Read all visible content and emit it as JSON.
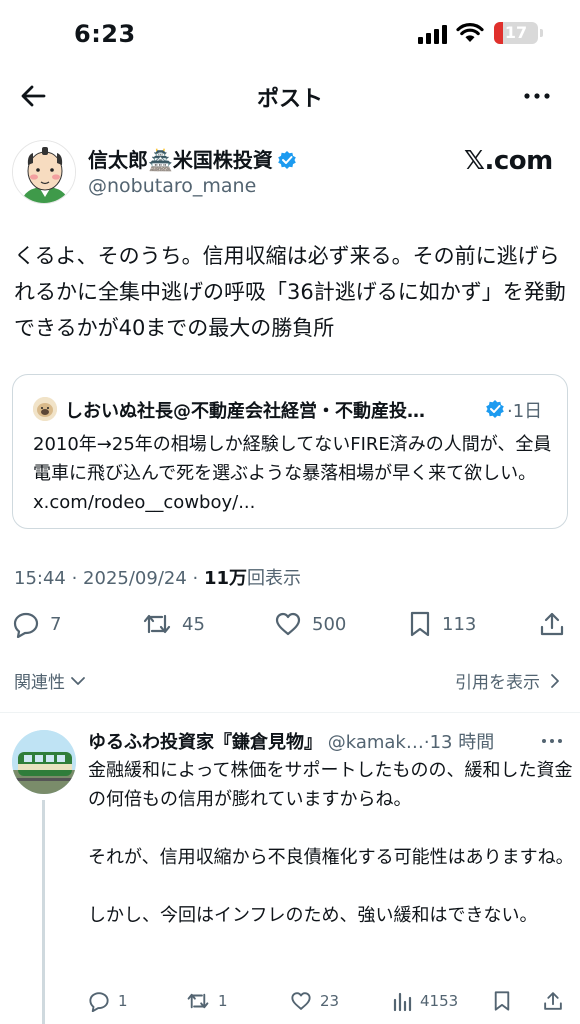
{
  "status": {
    "time": "6:23",
    "battery": "17"
  },
  "nav": {
    "title": "ポスト"
  },
  "author": {
    "name": "信太郎🏯米国株投資",
    "handle": "@nobutaro_mane",
    "source": "𝕏.com"
  },
  "tweet": {
    "text": "くるよ、そのうち。信用収縮は必ず来る。その前に逃げられるかに全集中逃げの呼吸「36計逃げるに如かず」を発動できるかが40までの最大の勝負所",
    "timestamp": "15:44 · 2025/09/24 · ",
    "views": "11万",
    "views_suffix": "回表示"
  },
  "quote": {
    "name": "しおいぬ社長@不動産会社経営・不動産投…",
    "time": "·1日",
    "text": "2010年→25年の相場しか経験してないFIRE済みの人間が、全員電車に飛び込んで死を選ぶような暴落相場が早く来て欲しい。 x.com/rodeo__cowboy/..."
  },
  "actions": {
    "replies": "7",
    "reposts": "45",
    "likes": "500",
    "bookmarks": "113"
  },
  "replies_sort": {
    "label": "関連性",
    "quotes_link": "引用を表示"
  },
  "reply": {
    "name": "ゆるふわ投資家『鎌倉見物』",
    "handle": "@kamak…",
    "time": "·13 時間",
    "paragraphs": [
      "金融緩和によって株価をサポートしたものの、緩和した資金の何倍もの信用が膨れていますからね。",
      "それが、信用収縮から不良債権化する可能性はありますね。",
      "しかし、今回はインフレのため、強い緩和はできない。"
    ],
    "actions": {
      "replies": "1",
      "reposts": "1",
      "likes": "23",
      "views": "4153"
    }
  },
  "colors": {
    "text": "#0f1419",
    "muted": "#536471",
    "verified": "#1d9bf0",
    "border": "#cfd9de"
  }
}
